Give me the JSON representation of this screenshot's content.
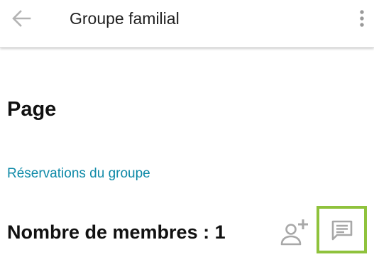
{
  "header": {
    "back_icon": "arrow-left-icon",
    "title": "Groupe familial",
    "menu_icon": "more-vertical-icon"
  },
  "main": {
    "page_heading": "Page",
    "group_link": "Réservations du groupe",
    "members_label": "Nombre de membres : 1",
    "add_member_icon": "person-add-icon",
    "chat_icon": "message-icon"
  },
  "colors": {
    "link": "#0f8aa8",
    "icon_gray": "#a8a8a8",
    "highlight_border": "#8fc23c",
    "text": "#111111"
  }
}
